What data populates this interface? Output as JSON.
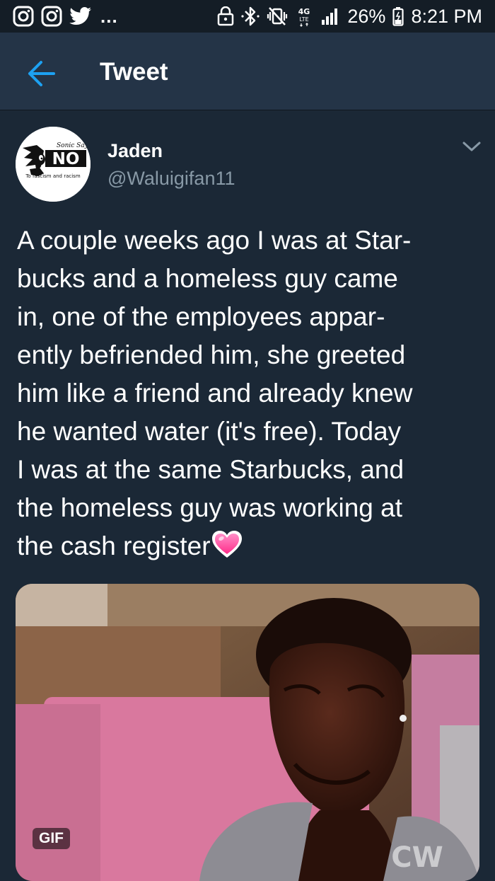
{
  "status_bar": {
    "battery": "26%",
    "time": "8:21 PM",
    "network": "4G LTE",
    "more": "...",
    "left_icons": [
      "instagram-icon",
      "instagram-icon",
      "twitter-icon"
    ],
    "right_icons": [
      "lock-icon",
      "bluetooth-icon",
      "vibrate-icon",
      "network-icon",
      "signal-icon",
      "battery-icon"
    ]
  },
  "header": {
    "title": "Tweet",
    "back_icon": "back-arrow-icon"
  },
  "tweet": {
    "author_name": "Jaden",
    "author_handle": "@Waluigifan11",
    "avatar": {
      "top_text": "Sonic Says",
      "main_text": "NO",
      "bottom_text": "To fascism and racism"
    },
    "menu_icon": "chevron-down-icon",
    "text_lines": [
      "A couple weeks ago I was at Star-",
      "bucks and a homeless guy came",
      "in, one of the employees appar-",
      "ently befriended him, she greeted",
      "him like a friend and already knew",
      "he wanted water (it's free). Today",
      "I was at the same Starbucks, and",
      "the homeless guy was working at",
      "the cash register"
    ],
    "emoji": "heart-emoji",
    "media": {
      "badge": "GIF",
      "watermark": "CW"
    }
  },
  "colors": {
    "status_bar_bg": "#141d26",
    "header_bg": "#243447",
    "page_bg": "#1b2836",
    "accent": "#1da1f2",
    "secondary_text": "#8899a6"
  }
}
